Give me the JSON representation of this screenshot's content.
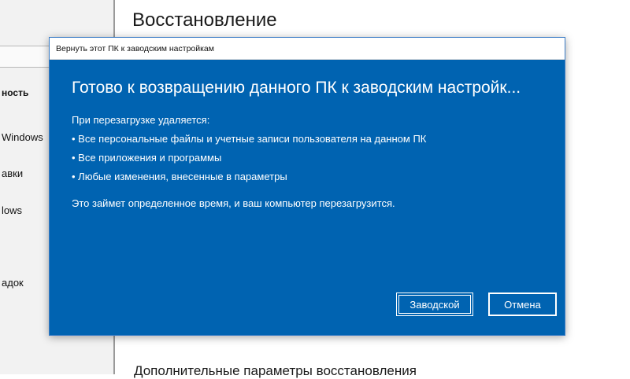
{
  "background": {
    "page_title": "Восстановление",
    "section_title": "Дополнительные параметры восстановления",
    "nav_items": [
      "ность",
      "Windows",
      "авки",
      "lows",
      "адок"
    ]
  },
  "dialog": {
    "window_title": "Вернуть этот ПК к заводским настройкам",
    "heading": "Готово к возвращению данного ПК к заводским настройк...",
    "intro": "При перезагрузке удаляется:",
    "bullets": [
      "• Все персональные файлы и учетные записи пользователя на данном ПК",
      "• Все приложения и программы",
      "• Любые изменения, внесенные в параметры"
    ],
    "note": "Это займет определенное время, и ваш компьютер перезагрузится.",
    "factory_button": "Заводской",
    "cancel_button": "Отмена"
  },
  "colors": {
    "dialog_background": "#0063b1",
    "text_on_dialog": "#ffffff"
  }
}
